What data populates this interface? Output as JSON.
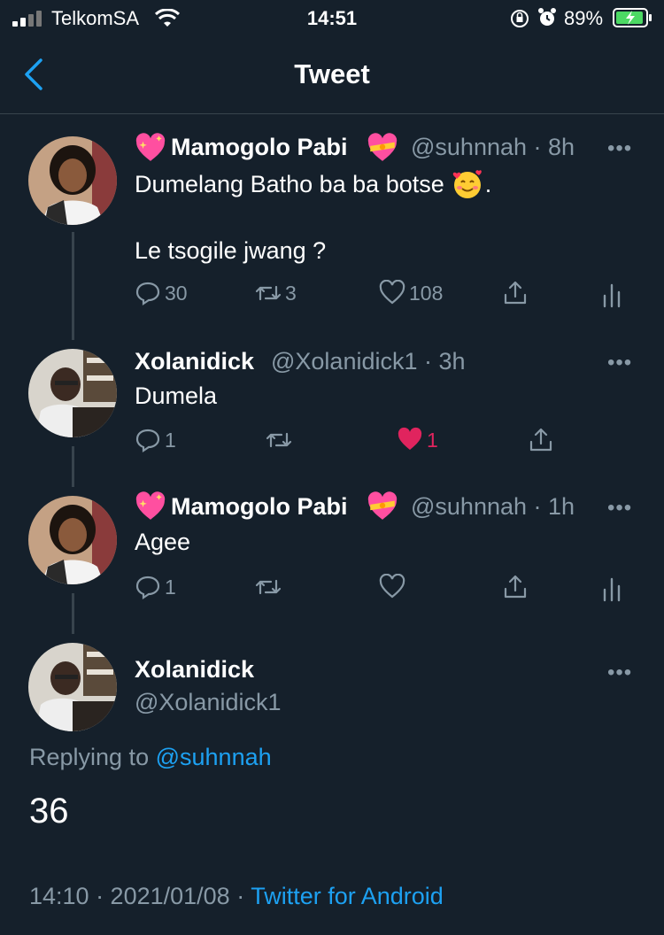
{
  "status_bar": {
    "carrier": "TelkomSA",
    "time": "14:51",
    "battery": "89%"
  },
  "header": {
    "title": "Tweet"
  },
  "tweets": [
    {
      "name": "Mamogolo Pabi",
      "meta": "@suhnnah · 8h",
      "text_line1": "Dumelang Batho ba ba botse",
      "text_line2": "Le tsogile jwang ?",
      "replies": "30",
      "retweets": "3",
      "likes": "108"
    },
    {
      "name": "Xolanidick",
      "meta": "@Xolanidick1 · 3h",
      "text_line1": "Dumela",
      "replies": "1",
      "likes": "1"
    },
    {
      "name": "Mamogolo Pabi",
      "meta": "@suhnnah · 1h",
      "text_line1": "Agee",
      "replies": "1"
    }
  ],
  "focused_tweet": {
    "name": "Xolanidick",
    "handle": "@Xolanidick1",
    "replying_prefix": "Replying to",
    "replying_to": "@suhnnah",
    "text": "36",
    "timestamp": "14:10 · 2021/01/08 ·",
    "source": "Twitter for Android"
  },
  "colors": {
    "background": "#15202b",
    "accent": "#1da1f2",
    "like": "#e0245e",
    "muted": "#8899a6"
  }
}
